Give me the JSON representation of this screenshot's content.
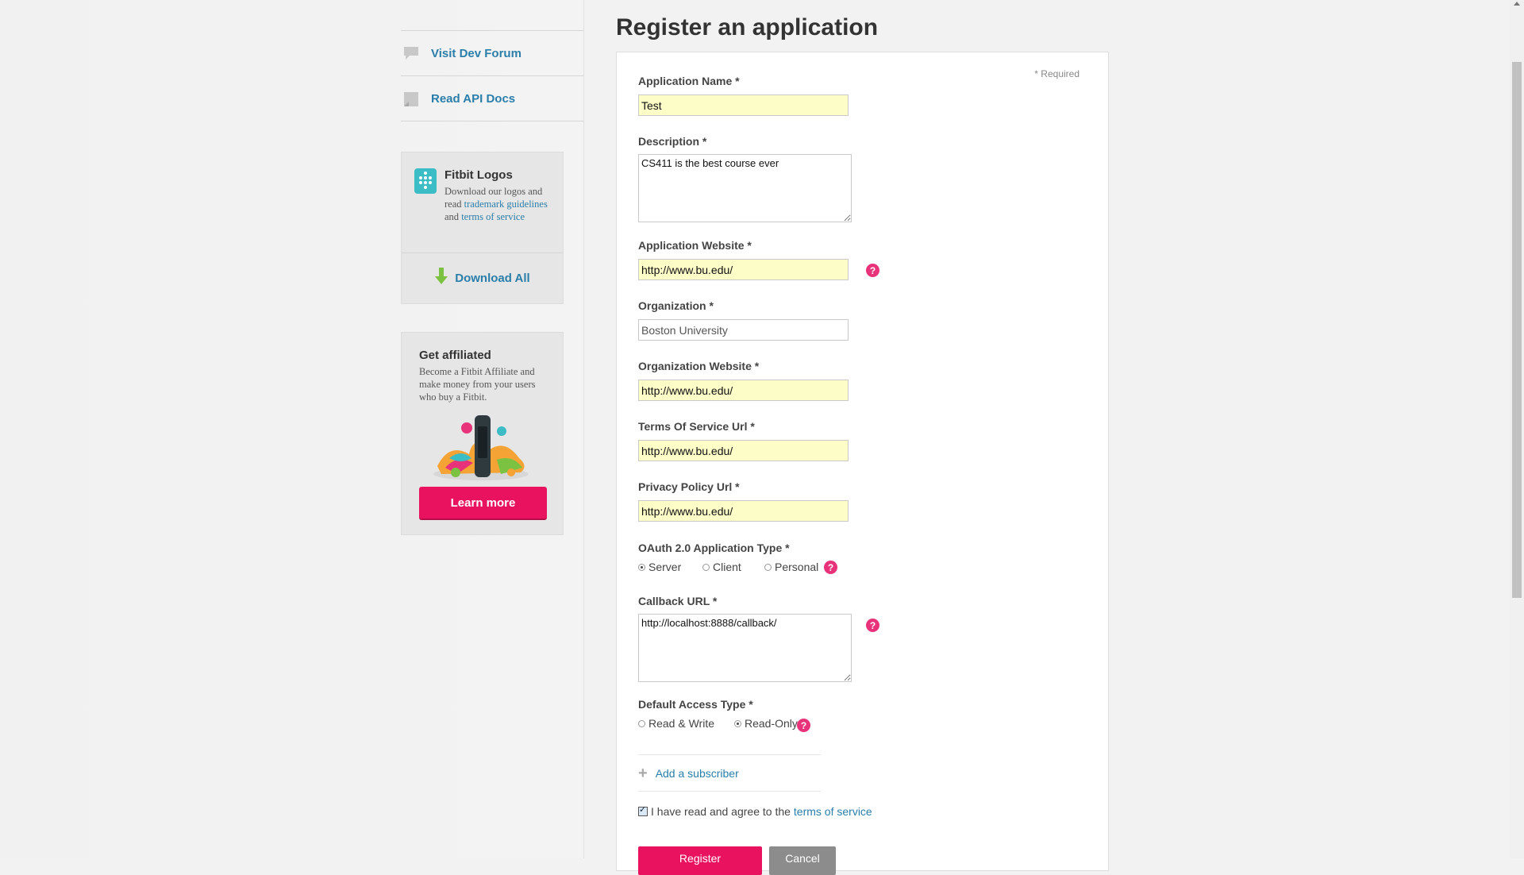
{
  "sidebar": {
    "nav": [
      {
        "label": "Visit Dev Forum",
        "icon": "speech-bubble-icon"
      },
      {
        "label": "Read API Docs",
        "icon": "document-icon"
      }
    ],
    "logos_box": {
      "title": "Fitbit Logos",
      "text_before": "Download our logos and read ",
      "link1": "trademark guidelines",
      "text_mid": " and ",
      "link2": "terms of service",
      "download_label": "Download All"
    },
    "affiliate_box": {
      "title": "Get affiliated",
      "text": "Become a Fitbit Affiliate and make money from your users who buy a Fitbit.",
      "button_label": "Learn more"
    }
  },
  "main": {
    "title": "Register an application",
    "required_note": "* Required",
    "fields": {
      "app_name": {
        "label": "Application Name *",
        "value": "Test"
      },
      "description": {
        "label": "Description *",
        "value": "CS411 is the best course ever"
      },
      "app_website": {
        "label": "Application Website *",
        "value": "http://www.bu.edu/"
      },
      "organization": {
        "label": "Organization *",
        "value": "Boston University"
      },
      "org_website": {
        "label": "Organization Website *",
        "value": "http://www.bu.edu/"
      },
      "tos_url": {
        "label": "Terms Of Service Url *",
        "value": "http://www.bu.edu/"
      },
      "privacy_url": {
        "label": "Privacy Policy Url *",
        "value": "http://www.bu.edu/"
      },
      "oauth_type": {
        "label": "OAuth 2.0 Application Type *",
        "options": [
          "Server",
          "Client",
          "Personal"
        ],
        "selected": "Server"
      },
      "callback_url": {
        "label": "Callback URL *",
        "value": "http://localhost:8888/callback/"
      },
      "access_type": {
        "label": "Default Access Type *",
        "options": [
          "Read & Write",
          "Read-Only"
        ],
        "selected": "Read-Only"
      }
    },
    "add_subscriber": "Add a subscriber",
    "agree_text": "I have read and agree to the",
    "agree_link": "terms of service",
    "agree_checked": true,
    "register_label": "Register",
    "cancel_label": "Cancel",
    "help_glyph": "?"
  },
  "colors": {
    "accent_pink": "#e8125f",
    "link_blue": "#2a7eaa",
    "autofill_yellow": "#fdfdc8",
    "fitbit_teal": "#3cbcc4"
  }
}
